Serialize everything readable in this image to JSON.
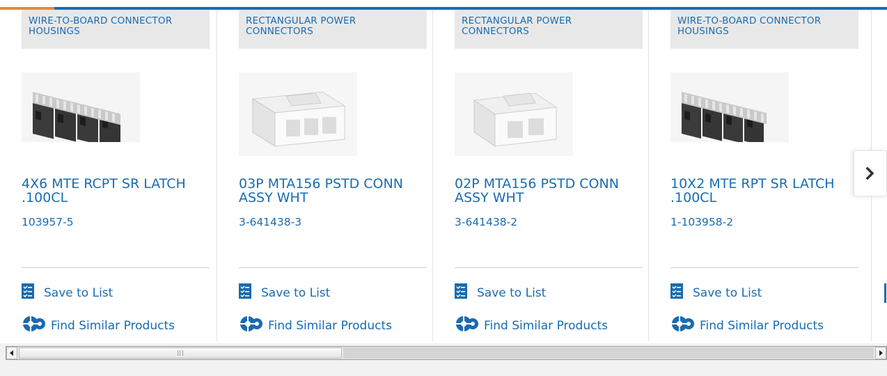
{
  "products": [
    {
      "category": "WIRE-TO-BOARD CONNECTOR HOUSINGS",
      "title": "4X6 MTE RCPT SR LATCH .100CL",
      "part_number": "103957-5",
      "save_label": "Save to List",
      "similar_label": "Find Similar Products",
      "image_icon": "multi-housing-connector-image"
    },
    {
      "category": "RECTANGULAR POWER CONNECTORS",
      "title": "03P MTA156 PSTD CONN ASSY WHT",
      "part_number": "3-641438-3",
      "save_label": "Save to List",
      "similar_label": "Find Similar Products",
      "image_icon": "white-power-connector-image"
    },
    {
      "category": "RECTANGULAR POWER CONNECTORS",
      "title": "02P MTA156 PSTD CONN ASSY WHT",
      "part_number": "3-641438-2",
      "save_label": "Save to List",
      "similar_label": "Find Similar Products",
      "image_icon": "white-power-connector-image"
    },
    {
      "category": "WIRE-TO-BOARD CONNECTOR HOUSINGS",
      "title": "10X2 MTE RPT SR LATCH .100CL",
      "part_number": "1-103958-2",
      "save_label": "Save to List",
      "similar_label": "Find Similar Products",
      "image_icon": "multi-housing-connector-image"
    }
  ],
  "colors": {
    "link": "#1a6bb0",
    "accent_orange": "#e8883a",
    "category_bg": "#e8e8e8"
  },
  "scrollbar": {
    "thumb_fraction": 0.37
  }
}
